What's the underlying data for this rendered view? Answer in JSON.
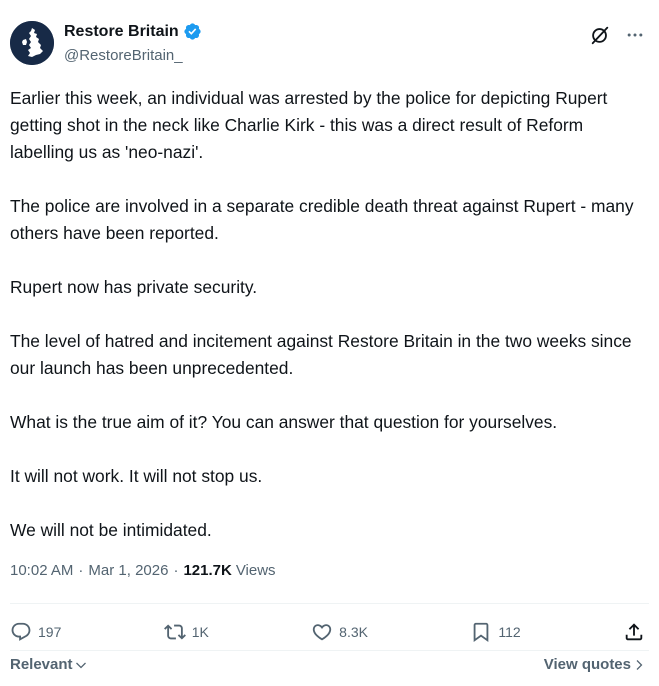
{
  "author": {
    "display_name": "Restore Britain",
    "handle": "@RestoreBritain_",
    "verified_color": "#1d9bf0",
    "avatar_icon": "britain-map-icon"
  },
  "tweet": {
    "paragraphs": [
      "Earlier this week, an individual was arrested by the police for depicting Rupert getting shot in the neck like Charlie Kirk - this was a direct result of Reform labelling us as 'neo-nazi'.",
      "The police are involved in a separate credible death threat against Rupert - many others have been reported.",
      "Rupert now has private security.",
      "The level of hatred and incitement against Restore Britain in the two weeks since our launch has been unprecedented.",
      "What is the true aim of it? You can answer that question for yourselves.",
      "It will not work. It will not stop us.",
      "We will not be intimidated."
    ],
    "time": "10:02 AM",
    "date": "Mar 1, 2026",
    "views_count": "121.7K",
    "views_label": "Views"
  },
  "actions": {
    "replies": "197",
    "reposts": "1K",
    "likes": "8.3K",
    "bookmarks": "112"
  },
  "footer": {
    "sort_label": "Relevant",
    "quotes_label": "View quotes"
  }
}
